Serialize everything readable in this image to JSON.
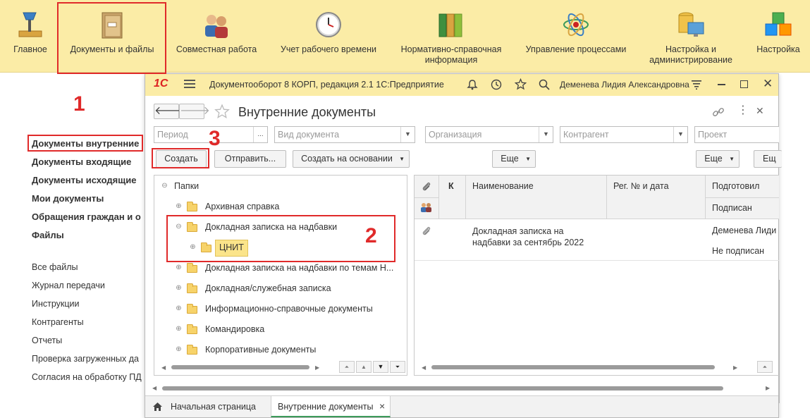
{
  "sections": [
    {
      "label": "Главное",
      "icon": "desk-lamp-icon"
    },
    {
      "label": "Документы и файлы",
      "icon": "document-folder-icon"
    },
    {
      "label": "Совместная работа",
      "icon": "people-icon"
    },
    {
      "label": "Учет рабочего времени",
      "icon": "clock-icon"
    },
    {
      "label": "Нормативно-справочная информация",
      "icon": "binders-icon"
    },
    {
      "label": "Управление процессами",
      "icon": "atom-icon"
    },
    {
      "label": "Настройка и администрирование",
      "icon": "database-monitor-icon"
    },
    {
      "label": "Настройка",
      "icon": "cubes-icon"
    }
  ],
  "left_menu": {
    "bold": [
      "Документы внутренние",
      "Документы входящие",
      "Документы исходящие",
      "Мои документы",
      "Обращения граждан и о",
      "Файлы"
    ],
    "normal": [
      "Все файлы",
      "Журнал передачи",
      "Инструкции",
      "Контрагенты",
      "Отчеты",
      "Проверка загруженных да",
      "Согласия на обработку ПД"
    ]
  },
  "markers": {
    "one": "1",
    "two": "2",
    "three": "3"
  },
  "window": {
    "logo": "1С",
    "title": "Документооборот 8 КОРП, редакция 2.1 1С:Предприятие",
    "user": "Деменева Лидия Александровна"
  },
  "form": {
    "title": "Внутренние документы",
    "filters": {
      "period": "Период",
      "period_btn": "...",
      "doc_type": "Вид документа",
      "organization": "Организация",
      "counterparty": "Контрагент",
      "project": "Проект"
    },
    "buttons": {
      "create": "Создать",
      "send": "Отправить...",
      "create_based": "Создать на основании",
      "more1": "Еще",
      "more2": "Еще",
      "more3": "Ещ"
    }
  },
  "tree": {
    "root": "Папки",
    "items": [
      "Архивная справка",
      "Докладная записка на надбавки",
      "ЦНИТ",
      "Докладная записка на надбавки по темам Н...",
      "Докладная/служебная записка",
      "Информационно-справочные документы",
      "Командировка",
      "Корпоративные документы"
    ]
  },
  "list": {
    "headers": {
      "k": "К",
      "name": "Наименование",
      "reg": "Рег. № и дата",
      "prepared": "Подготовил",
      "signed": "Подписан"
    },
    "rows": [
      {
        "name": "Докладная записка на надбавки за сентябрь 2022",
        "prepared": "Деменева Лиди",
        "signed": "Не подписан"
      }
    ]
  },
  "tabs": {
    "home": "Начальная страница",
    "current": "Внутренние документы",
    "close": "×"
  },
  "colors": {
    "topbar": "#fbeca6",
    "marker": "#e02a2a",
    "selected": "#fbe48a"
  }
}
